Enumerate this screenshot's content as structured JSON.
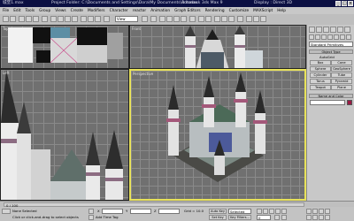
{
  "titlebar": {
    "app_short": "城堡1.max",
    "project": "Project Folder: C:\\Documents and Settings\\Dora\\My Documents\\3dsmax",
    "app_name": "Autodesk 3ds Max 9",
    "display": "Display : Direct 3D"
  },
  "menubar": {
    "items": [
      "File",
      "Edit",
      "Tools",
      "Group",
      "Views",
      "Create",
      "Modifiers",
      "Character",
      "reactor",
      "Animation",
      "Graph Editors",
      "Rendering",
      "Customize",
      "MAXScript",
      "Help"
    ]
  },
  "toolbar": {
    "view_select": "View"
  },
  "viewports": {
    "top": {
      "label": "Top"
    },
    "front": {
      "label": "Front"
    },
    "left": {
      "label": "Left"
    },
    "perspective": {
      "label": "Perspective"
    }
  },
  "command_panel": {
    "category": "Standard Primitives",
    "object_type": "Object Type",
    "autogrid": "AutoGrid",
    "primitives": [
      "Box",
      "Cone",
      "Sphere",
      "GeoSphere",
      "Cylinder",
      "Tube",
      "Torus",
      "Pyramid",
      "Teapot",
      "Plane"
    ],
    "name_and_color": "Name and Color"
  },
  "trackbar": {
    "frame": "0 / 100"
  },
  "statusbar": {
    "selection": "None Selected",
    "prompt": "Click or click-and-drag to select objects",
    "x_label": "X",
    "y_label": "Y",
    "z_label": "Z",
    "grid": "Grid = 10.0",
    "auto_key": "Auto Key",
    "selected": "Selected",
    "set_key": "Set Key",
    "key_filters": "Key Filters...",
    "add_time_tag": "Add Time Tag",
    "frame_field": "0"
  },
  "colors": {
    "titlebar": "#0b0f42",
    "active_viewport_border": "#e8e25a",
    "viewport_bg": "#707070"
  }
}
